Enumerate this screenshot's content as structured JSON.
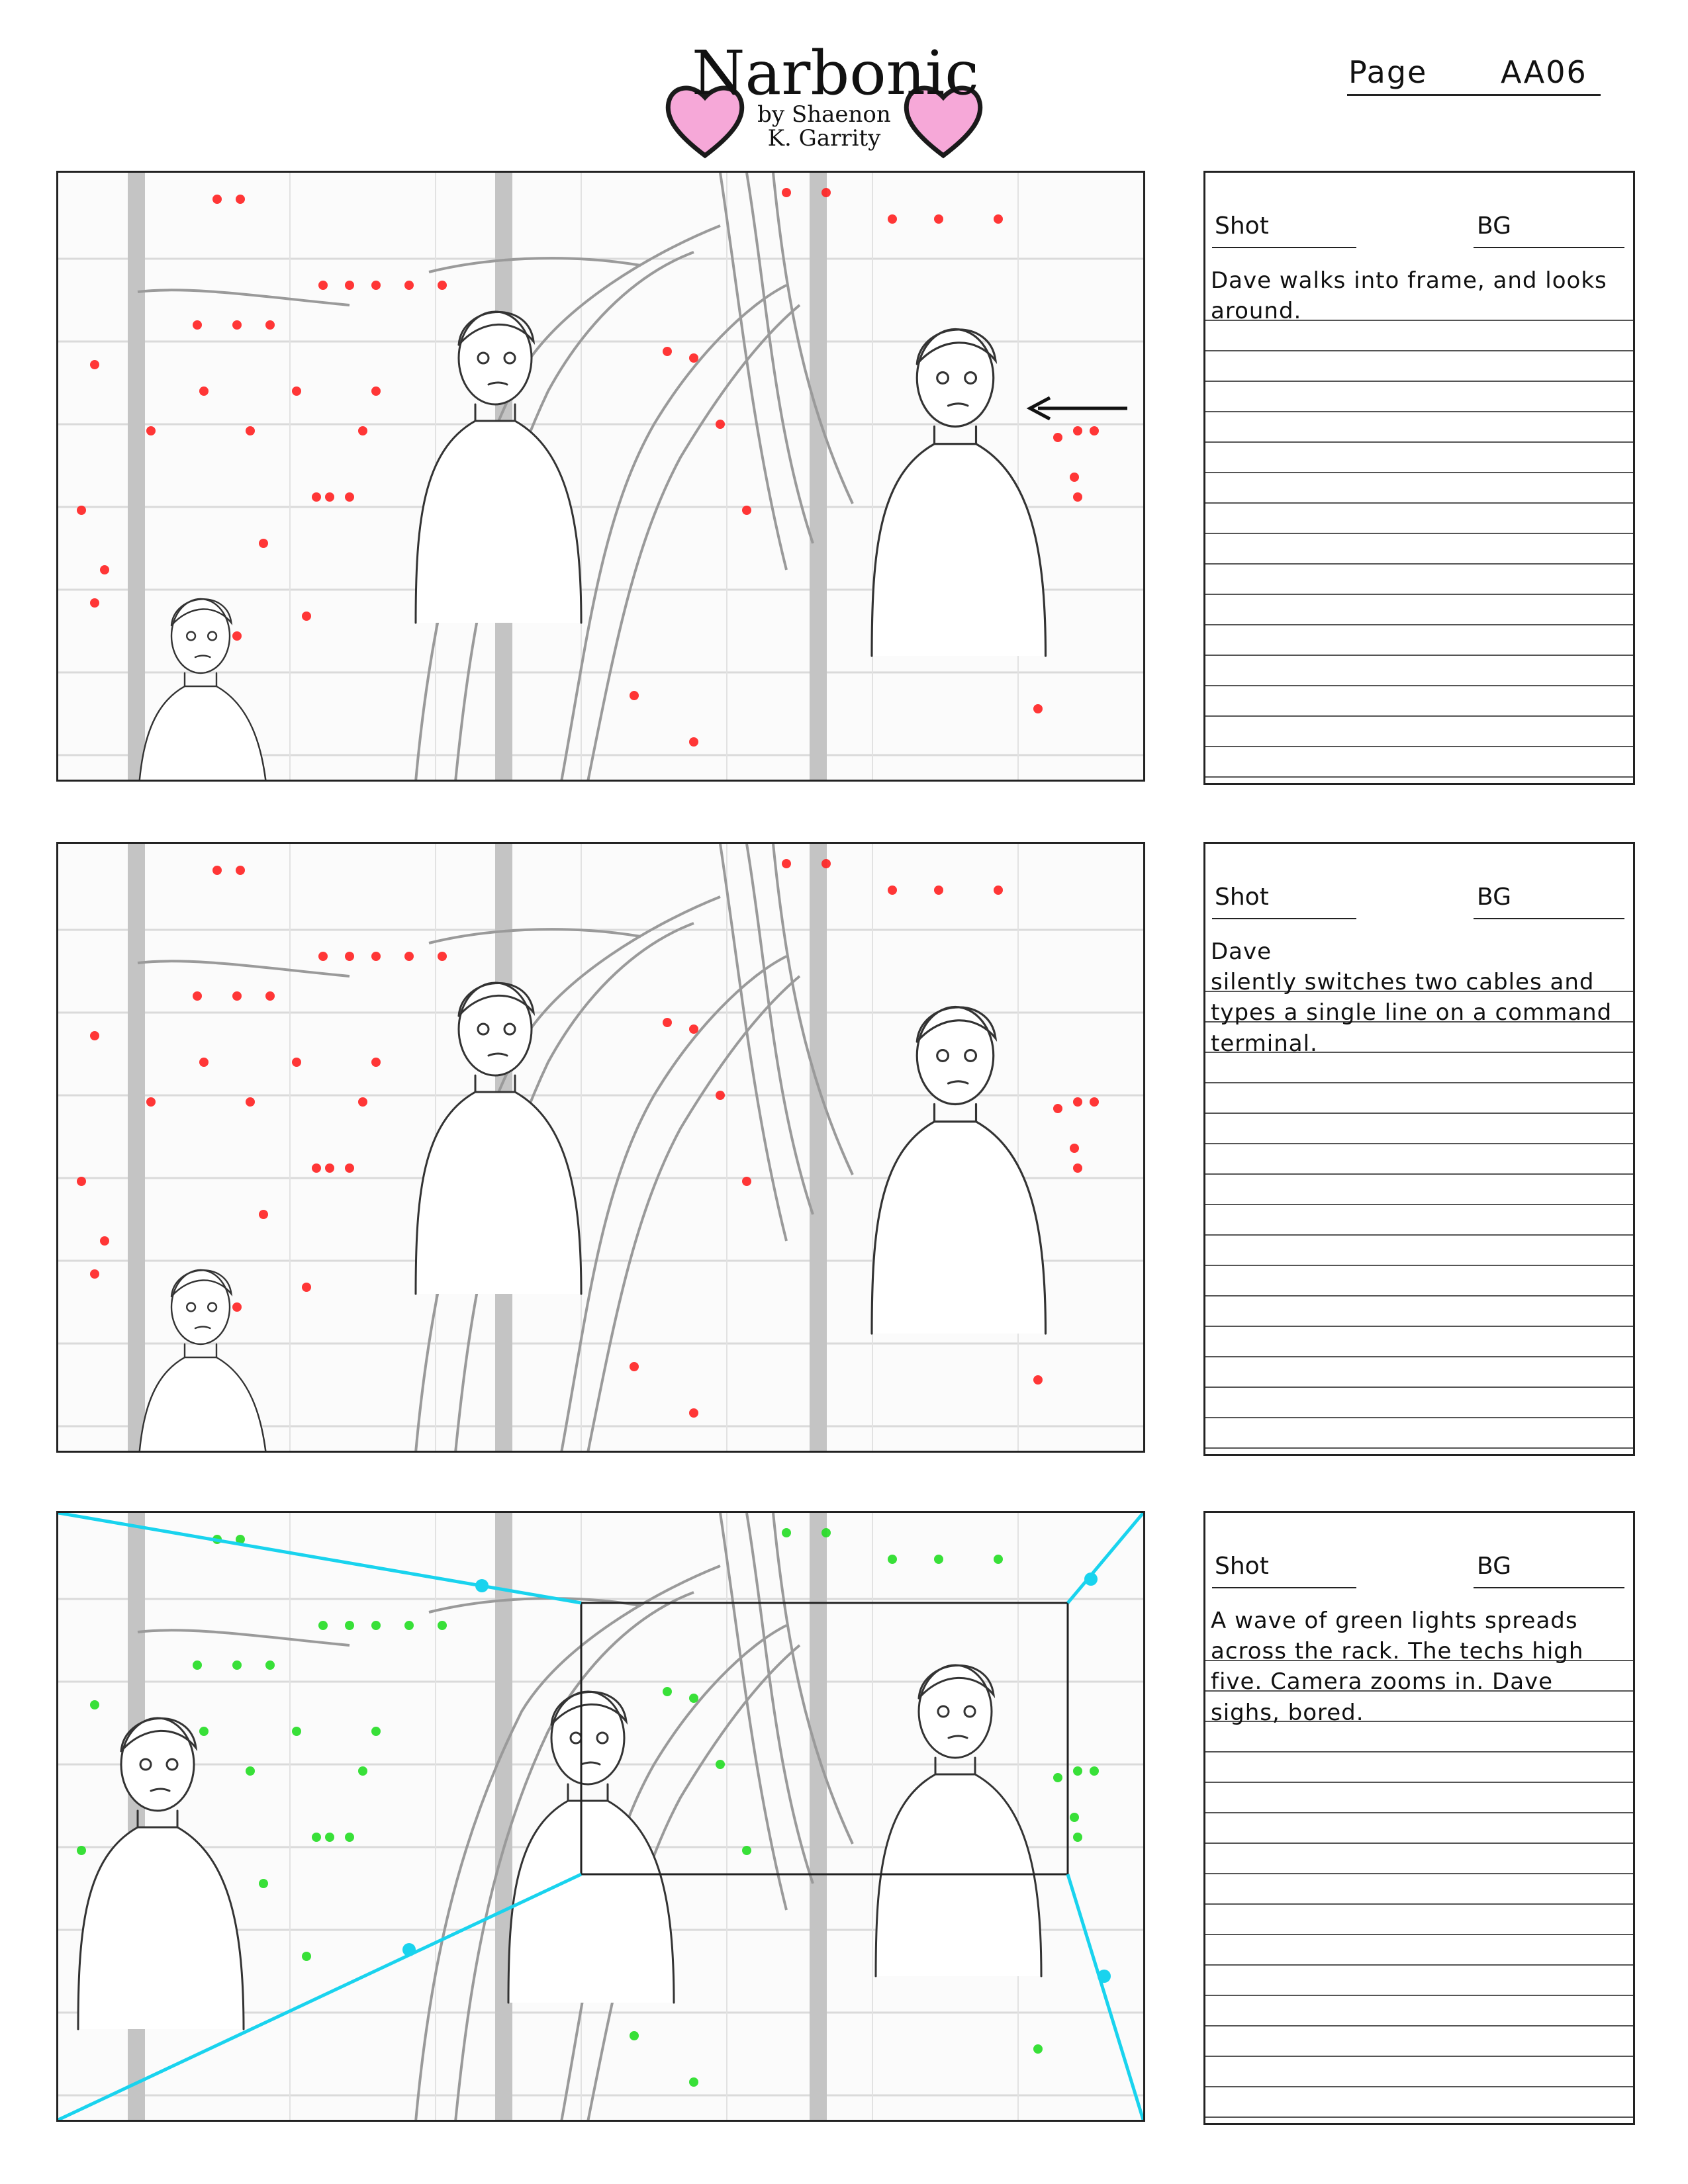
{
  "header": {
    "logo_title": "Narbonic",
    "logo_byline_1": "by Shaenon",
    "logo_byline_2": "K. Garrity",
    "page_label": "Page",
    "page_value": "AA06"
  },
  "colors": {
    "heart_fill": "#f6a8d8",
    "heart_stroke": "#1a1a1a",
    "red_light": "#ff2020",
    "green_light": "#22dd22",
    "camera_path": "#19d3ee",
    "sketch_line": "#9a9a9a",
    "rack_post": "#c4c4c4"
  },
  "panels": [
    {
      "shot_label": "Shot",
      "bg_label": "BG",
      "description": "Dave walks into frame, and looks around.",
      "light_color": "red",
      "has_walk_arrow": true,
      "has_camera_zoom": false
    },
    {
      "shot_label": "Shot",
      "bg_label": "BG",
      "description": "Dave\nsilently switches two cables and types a single line on a command terminal.",
      "light_color": "red",
      "has_walk_arrow": false,
      "has_camera_zoom": false
    },
    {
      "shot_label": "Shot",
      "bg_label": "BG",
      "description": "A wave of green lights spreads across the rack. The techs high five. Camera zooms in. Dave sighs, bored.",
      "light_color": "green",
      "has_walk_arrow": false,
      "has_camera_zoom": true
    }
  ]
}
